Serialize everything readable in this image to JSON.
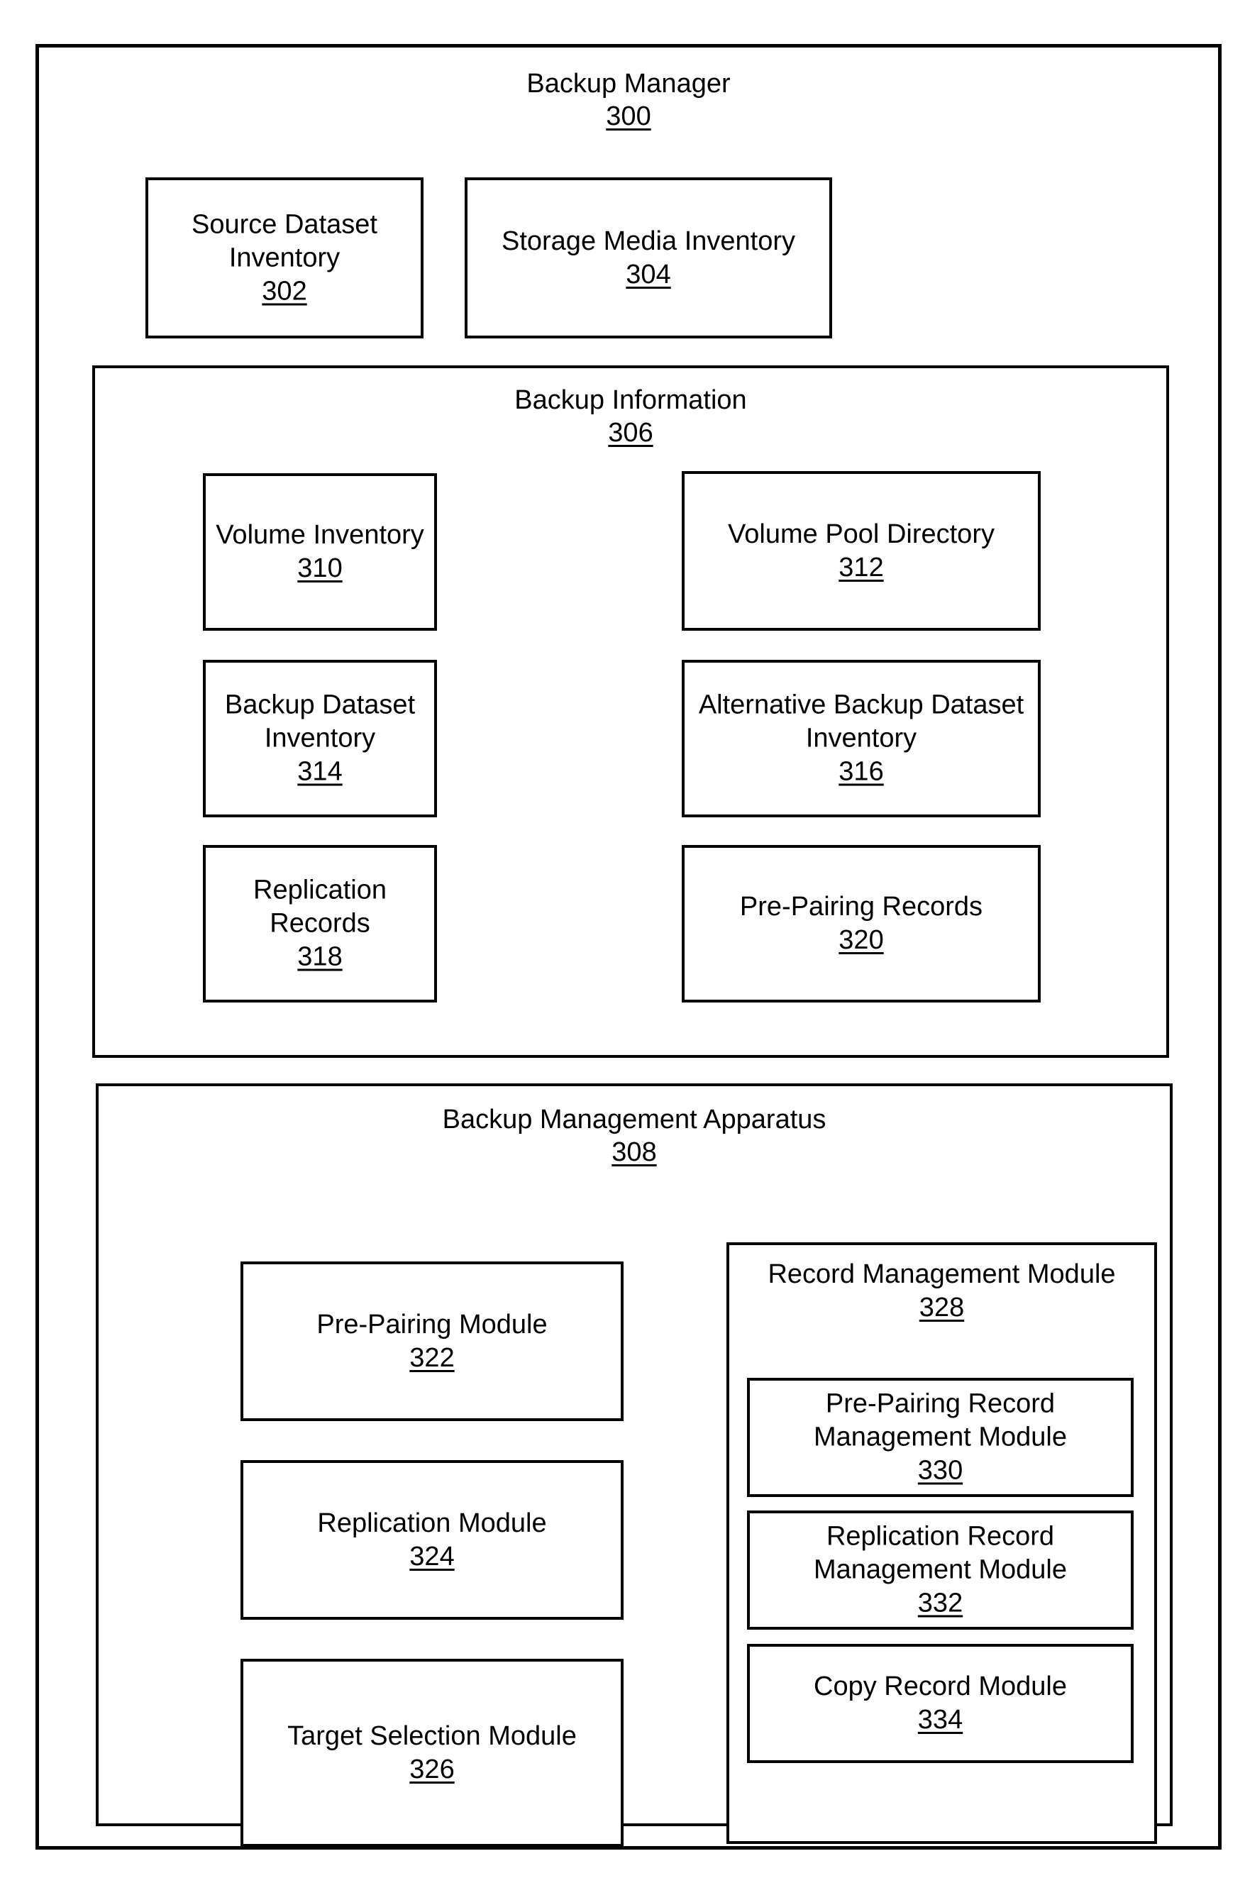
{
  "figure": {
    "type": "patent-block-diagram",
    "root": {
      "title": "Backup Manager",
      "ref": "300"
    },
    "blocks": [
      {
        "id": "302",
        "title": "Source Dataset Inventory",
        "lines": [
          "Source Dataset",
          "Inventory"
        ],
        "ref": "302"
      },
      {
        "id": "304",
        "title": "Storage Media Inventory",
        "lines": [
          "Storage Media Inventory"
        ],
        "ref": "304"
      },
      {
        "id": "306",
        "title": "Backup Information",
        "lines": [
          "Backup Information"
        ],
        "ref": "306"
      },
      {
        "id": "310",
        "title": "Volume Inventory",
        "lines": [
          "Volume Inventory"
        ],
        "ref": "310"
      },
      {
        "id": "312",
        "title": "Volume Pool Directory",
        "lines": [
          "Volume Pool",
          "Directory"
        ],
        "ref": "312"
      },
      {
        "id": "314",
        "title": "Backup Dataset Inventory",
        "lines": [
          "Backup Dataset",
          "Inventory"
        ],
        "ref": "314"
      },
      {
        "id": "316",
        "title": "Alternative Backup Dataset Inventory",
        "lines": [
          "Alternative Backup",
          "Dataset Inventory"
        ],
        "ref": "316"
      },
      {
        "id": "318",
        "title": "Replication Records",
        "lines": [
          "Replication Records"
        ],
        "ref": "318"
      },
      {
        "id": "320",
        "title": "Pre-Pairing Records",
        "lines": [
          "Pre-Pairing Records"
        ],
        "ref": "320"
      },
      {
        "id": "308",
        "title": "Backup Management Apparatus",
        "lines": [
          "Backup Management Apparatus"
        ],
        "ref": "308"
      },
      {
        "id": "322",
        "title": "Pre-Pairing Module",
        "lines": [
          "Pre-Pairing Module"
        ],
        "ref": "322"
      },
      {
        "id": "324",
        "title": "Replication Module",
        "lines": [
          "Replication Module"
        ],
        "ref": "324"
      },
      {
        "id": "326",
        "title": "Target Selection Module",
        "lines": [
          "Target Selection",
          "Module"
        ],
        "ref": "326"
      },
      {
        "id": "328",
        "title": "Record Management Module",
        "lines": [
          "Record Management",
          "Module"
        ],
        "ref": "328"
      },
      {
        "id": "330",
        "title": "Pre-Pairing Record Management Module",
        "lines": [
          "Pre-Pairing Record",
          "Management Module"
        ],
        "ref": "330"
      },
      {
        "id": "332",
        "title": "Replication Record Management Module",
        "lines": [
          "Replication Record",
          "Management Module"
        ],
        "ref": "332"
      },
      {
        "id": "334",
        "title": "Copy Record Module",
        "lines": [
          "Copy Record Module"
        ],
        "ref": "334"
      }
    ]
  },
  "backup_manager": {
    "title": "Backup Manager",
    "ref": "300"
  },
  "source_dataset_inventory": {
    "line1": "Source Dataset",
    "line2": "Inventory",
    "ref": "302"
  },
  "storage_media_inventory": {
    "line1": "Storage Media Inventory",
    "ref": "304"
  },
  "backup_information": {
    "title": "Backup Information",
    "ref": "306",
    "volume_inventory": {
      "line1": "Volume Inventory",
      "ref": "310"
    },
    "volume_pool_directory": {
      "line1": "Volume Pool",
      "line2": "Directory",
      "ref": "312"
    },
    "backup_dataset_inventory": {
      "line1": "Backup Dataset",
      "line2": "Inventory",
      "ref": "314"
    },
    "alternative_backup_dataset_inventory": {
      "line1": "Alternative Backup",
      "line2": "Dataset Inventory",
      "ref": "316"
    },
    "replication_records": {
      "line1": "Replication Records",
      "ref": "318"
    },
    "pre_pairing_records": {
      "line1": "Pre-Pairing Records",
      "ref": "320"
    }
  },
  "backup_management_apparatus": {
    "title": "Backup Management Apparatus",
    "ref": "308",
    "pre_pairing_module": {
      "line1": "Pre-Pairing Module",
      "ref": "322"
    },
    "replication_module": {
      "line1": "Replication Module",
      "ref": "324"
    },
    "target_selection_module": {
      "line1": "Target Selection",
      "line2": "Module",
      "ref": "326"
    },
    "record_management_module": {
      "line1": "Record Management",
      "line2": "Module",
      "ref": "328",
      "pre_pairing_record_management_module": {
        "line1": "Pre-Pairing Record",
        "line2": "Management Module",
        "ref": "330"
      },
      "replication_record_management_module": {
        "line1": "Replication Record",
        "line2": "Management Module",
        "ref": "332"
      },
      "copy_record_module": {
        "line1": "Copy Record Module",
        "ref": "334"
      }
    }
  }
}
